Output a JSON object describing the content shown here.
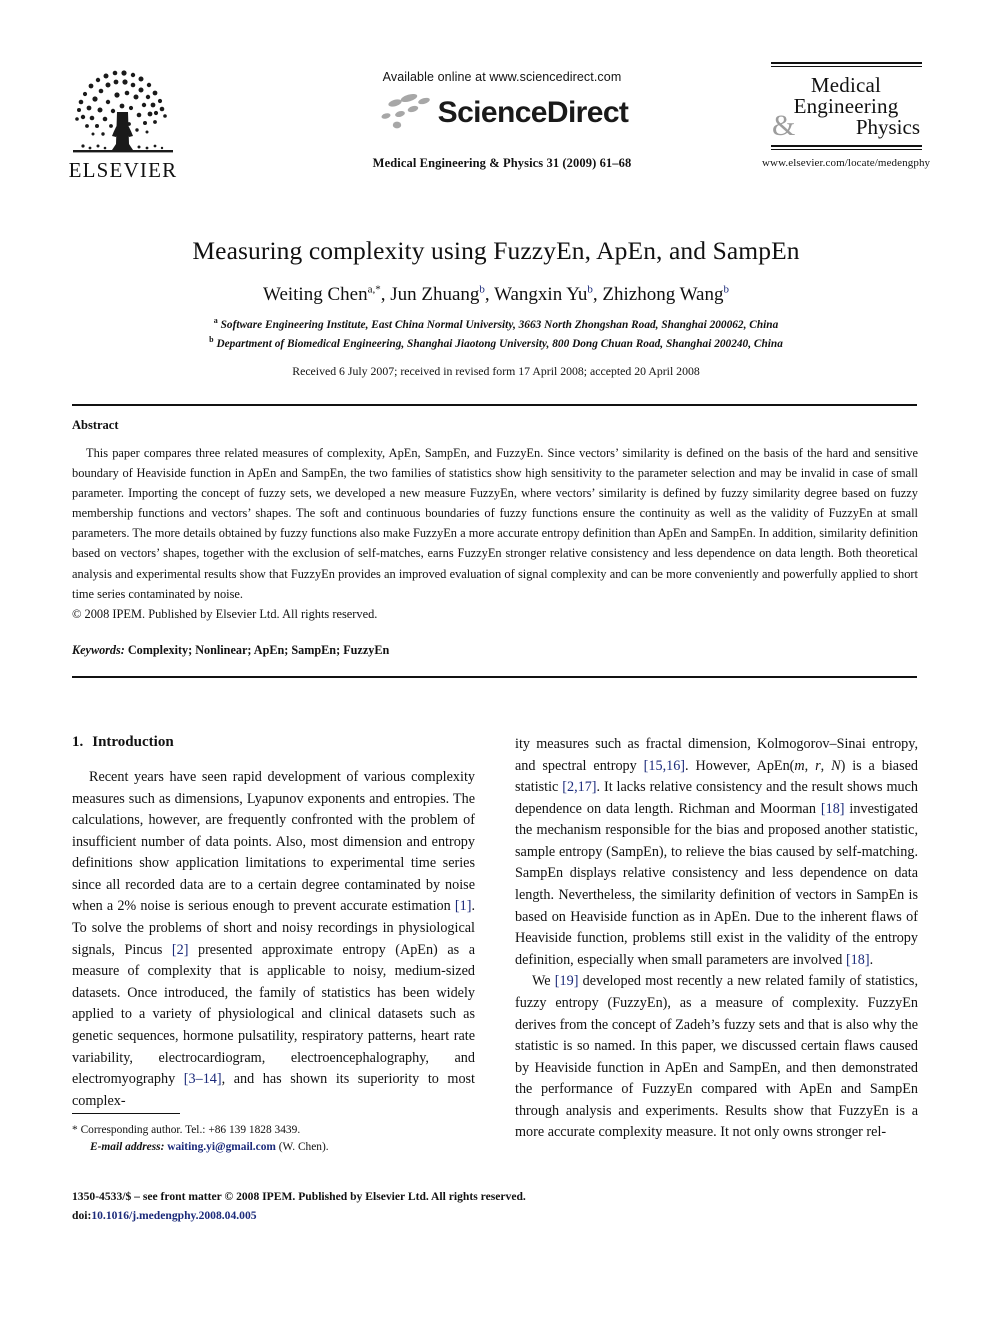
{
  "header": {
    "publisher_name": "ELSEVIER",
    "publisher_logo_icon": "elsevier-tree-icon",
    "available_online": "Available online at www.sciencedirect.com",
    "sciencedirect_wordmark": "ScienceDirect",
    "sciencedirect_mark_icon": "sciencedirect-dots-icon",
    "journal_reference": "Medical Engineering & Physics 31 (2009) 61–68",
    "journal_logo": {
      "line1": "Medical",
      "line2": "Engineering",
      "ampersand": "&",
      "line3": "Physics"
    },
    "journal_url": "www.elsevier.com/locate/medengphy"
  },
  "article": {
    "title": "Measuring complexity using FuzzyEn, ApEn, and SampEn",
    "authors": [
      {
        "name": "Weiting Chen",
        "marks": "a,*"
      },
      {
        "name": "Jun Zhuang",
        "marks": "b"
      },
      {
        "name": "Wangxin Yu",
        "marks": "b"
      },
      {
        "name": "Zhizhong Wang",
        "marks": "b"
      }
    ],
    "affiliations": [
      {
        "label": "a",
        "text": "Software Engineering Institute, East China Normal University, 3663 North Zhongshan Road, Shanghai 200062, China"
      },
      {
        "label": "b",
        "text": "Department of Biomedical Engineering, Shanghai Jiaotong University, 800 Dong Chuan Road, Shanghai 200240, China"
      }
    ],
    "history": "Received 6 July 2007; received in revised form 17 April 2008; accepted 20 April 2008"
  },
  "abstract": {
    "heading": "Abstract",
    "text": "This paper compares three related measures of complexity, ApEn, SampEn, and FuzzyEn. Since vectors’ similarity is defined on the basis of the hard and sensitive boundary of Heaviside function in ApEn and SampEn, the two families of statistics show high sensitivity to the parameter selection and may be invalid in case of small parameter. Importing the concept of fuzzy sets, we developed a new measure FuzzyEn, where vectors’ similarity is defined by fuzzy similarity degree based on fuzzy membership functions and vectors’ shapes. The soft and continuous boundaries of fuzzy functions ensure the continuity as well as the validity of FuzzyEn at small parameters. The more details obtained by fuzzy functions also make FuzzyEn a more accurate entropy definition than ApEn and SampEn. In addition, similarity definition based on vectors’ shapes, together with the exclusion of self-matches, earns FuzzyEn stronger relative consistency and less dependence on data length. Both theoretical analysis and experimental results show that FuzzyEn provides an improved evaluation of signal complexity and can be more conveniently and powerfully applied to short time series contaminated by noise.",
    "copyright": "© 2008 IPEM. Published by Elsevier Ltd. All rights reserved."
  },
  "keywords": {
    "label": "Keywords:",
    "values": "Complexity; Nonlinear; ApEn; SampEn; FuzzyEn"
  },
  "introduction": {
    "number": "1.",
    "heading": "Introduction",
    "left_paragraph_1_a": "Recent years have seen rapid development of various complexity measures such as dimensions, Lyapunov exponents and entropies. The calculations, however, are frequently confronted with the problem of insufficient number of data points. Also, most dimension and entropy definitions show application limitations to experimental time series since all recorded data are to a certain degree contaminated by noise when a 2% noise is serious enough to prevent accurate estimation ",
    "left_ref_1": "[1]",
    "left_paragraph_1_b": ". To solve the problems of short and noisy recordings in physiological signals, Pincus ",
    "left_ref_2": "[2]",
    "left_paragraph_1_c": " presented approximate entropy (ApEn) as a measure of complexity that is applicable to noisy, medium-sized datasets. Once introduced, the family of statistics has been widely applied to a variety of physiological and clinical datasets such as genetic sequences, hormone pulsatility, respiratory patterns, heart rate variability, electrocardiogram, electroencephalography, and electromyography ",
    "left_ref_3": "[3–14]",
    "left_paragraph_1_d": ", and has shown its superiority to most complex-",
    "right_paragraph_1_a": "ity measures such as fractal dimension, Kolmogorov–Sinai entropy, and spectral entropy ",
    "right_ref_1": "[15,16]",
    "right_paragraph_1_b": ". However, ApEn(",
    "right_italic_m": "m",
    "right_paragraph_1_c": ", ",
    "right_italic_r": "r",
    "right_paragraph_1_d": ", ",
    "right_italic_N": "N",
    "right_paragraph_1_e": ") is a biased statistic ",
    "right_ref_2": "[2,17]",
    "right_paragraph_1_f": ". It lacks relative consistency and the result shows much dependence on data length. Richman and Moorman ",
    "right_ref_3": "[18]",
    "right_paragraph_1_g": " investigated the mechanism responsible for the bias and proposed another statistic, sample entropy (SampEn), to relieve the bias caused by self-matching. SampEn displays relative consistency and less dependence on data length. Nevertheless, the similarity definition of vectors in SampEn is based on Heaviside function as in ApEn. Due to the inherent flaws of Heaviside function, problems still exist in the validity of the entropy definition, especially when small parameters are involved ",
    "right_ref_4": "[18]",
    "right_paragraph_1_h": ".",
    "right_paragraph_2_a": "We ",
    "right_ref_5": "[19]",
    "right_paragraph_2_b": " developed most recently a new related family of statistics, fuzzy entropy (FuzzyEn), as a measure of complexity. FuzzyEn derives from the concept of Zadeh’s fuzzy sets and that is also why the statistic is so named. In this paper, we discussed certain flaws caused by Heaviside function in ApEn and SampEn, and then demonstrated the performance of FuzzyEn compared with ApEn and SampEn through analysis and experiments. Results show that FuzzyEn is a more accurate complexity measure. It not only owns stronger rel-"
  },
  "footnote": {
    "star": "*",
    "corresponding": "Corresponding author. Tel.: +86 139 1828 3439.",
    "email_label": "E-mail address:",
    "email": "waiting.yi@gmail.com",
    "email_owner": "(W. Chen)."
  },
  "page_footer": {
    "issn_line": "1350-4533/$ – see front matter © 2008 IPEM. Published by Elsevier Ltd. All rights reserved.",
    "doi_label": "doi:",
    "doi": "10.1016/j.medengphy.2008.04.005"
  },
  "colors": {
    "link": "#1b2a7a",
    "text": "#111111",
    "rule": "#111111",
    "amp_gray": "#9d9d9d"
  }
}
